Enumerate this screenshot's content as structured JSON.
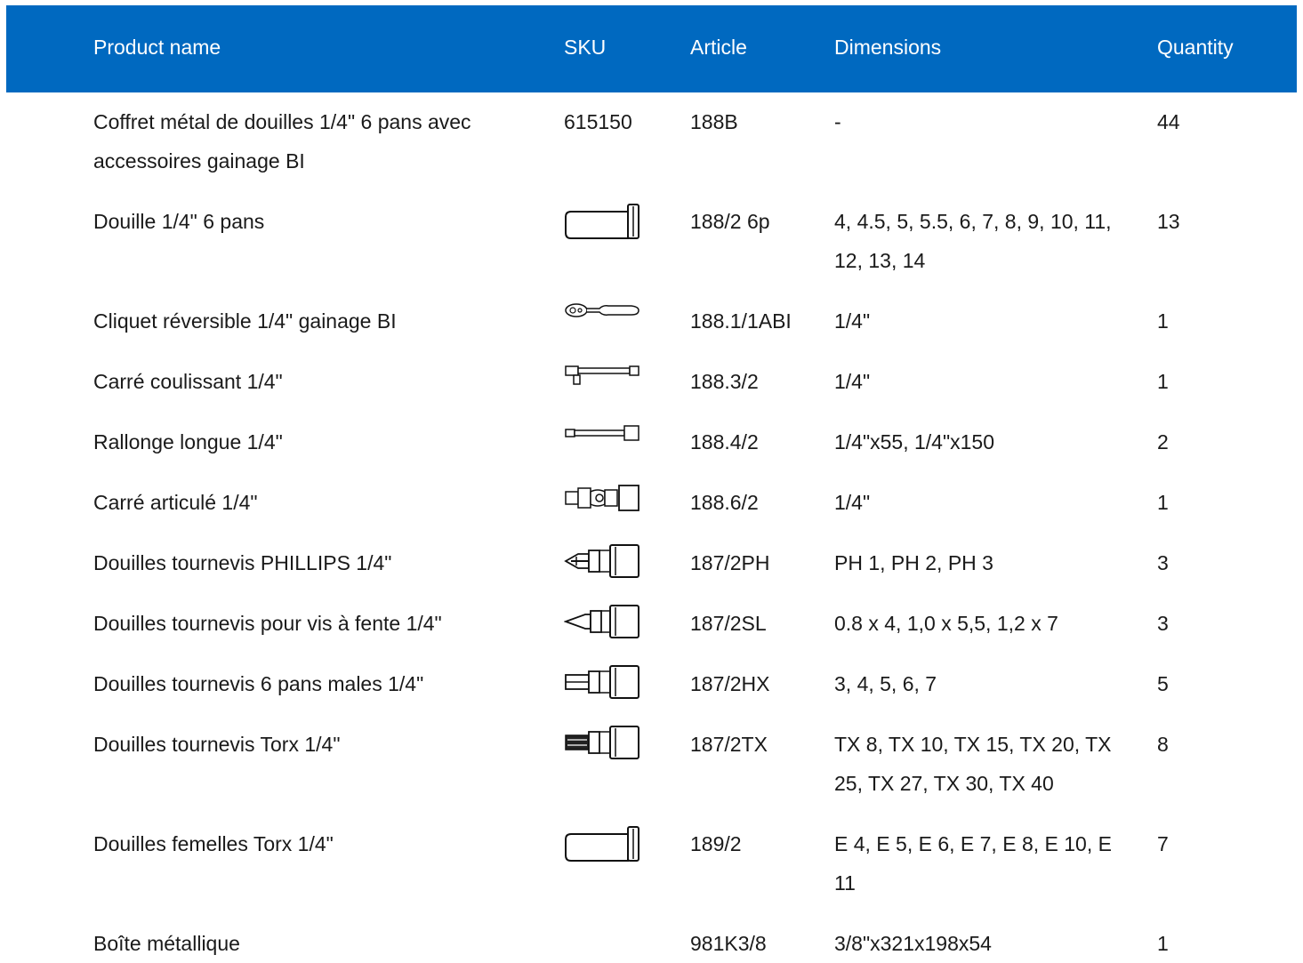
{
  "header": {
    "product_name": "Product name",
    "sku": "SKU",
    "article": "Article",
    "dimensions": "Dimensions",
    "quantity": "Quantity"
  },
  "colors": {
    "header_bg": "#0069c0",
    "header_text": "#ffffff",
    "body_text": "#1a1a1a"
  },
  "rows": [
    {
      "name": "Coffret métal de douilles 1/4\" 6 pans avec accessoires gainage BI",
      "sku": "615150",
      "icon": "",
      "article": "188B",
      "dimensions": "-",
      "quantity": "44"
    },
    {
      "name": "Douille 1/4\" 6 pans",
      "sku": "",
      "icon": "socket-icon",
      "article": "188/2 6p",
      "dimensions": "4, 4.5, 5, 5.5, 6, 7, 8, 9, 10, 11, 12, 13, 14",
      "quantity": "13"
    },
    {
      "name": "Cliquet réversible 1/4\" gainage BI",
      "sku": "",
      "icon": "ratchet-icon",
      "article": "188.1/1ABI",
      "dimensions": "1/4\"",
      "quantity": "1"
    },
    {
      "name": "Carré coulissant 1/4\"",
      "sku": "",
      "icon": "sliding-t-bar-icon",
      "article": "188.3/2",
      "dimensions": "1/4\"",
      "quantity": "1"
    },
    {
      "name": "Rallonge longue 1/4\"",
      "sku": "",
      "icon": "extension-bar-icon",
      "article": "188.4/2",
      "dimensions": "1/4\"x55, 1/4\"x150",
      "quantity": "2"
    },
    {
      "name": "Carré articulé 1/4\"",
      "sku": "",
      "icon": "universal-joint-icon",
      "article": "188.6/2",
      "dimensions": "1/4\"",
      "quantity": "1"
    },
    {
      "name": "Douilles tournevis PHILLIPS 1/4\"",
      "sku": "",
      "icon": "phillips-bit-socket-icon",
      "article": "187/2PH",
      "dimensions": "PH 1, PH 2, PH 3",
      "quantity": "3"
    },
    {
      "name": "Douilles tournevis pour vis à fente 1/4\"",
      "sku": "",
      "icon": "slotted-bit-socket-icon",
      "article": "187/2SL",
      "dimensions": "0.8 x 4, 1,0 x 5,5, 1,2 x 7",
      "quantity": "3"
    },
    {
      "name": "Douilles tournevis 6 pans males 1/4\"",
      "sku": "",
      "icon": "hex-bit-socket-icon",
      "article": "187/2HX",
      "dimensions": "3, 4, 5, 6, 7",
      "quantity": "5"
    },
    {
      "name": "Douilles tournevis Torx 1/4\"",
      "sku": "",
      "icon": "torx-bit-socket-icon",
      "article": "187/2TX",
      "dimensions": "TX 8, TX 10, TX 15, TX 20, TX 25, TX 27, TX 30, TX 40",
      "quantity": "8"
    },
    {
      "name": "Douilles femelles Torx 1/4\"",
      "sku": "",
      "icon": "female-torx-socket-icon",
      "article": "189/2",
      "dimensions": "E 4, E 5, E 6, E 7, E 8, E 10, E 11",
      "quantity": "7"
    },
    {
      "name": "Boîte métallique",
      "sku": "",
      "icon": "",
      "article": "981K3/8",
      "dimensions": "3/8\"x321x198x54",
      "quantity": "1"
    }
  ]
}
